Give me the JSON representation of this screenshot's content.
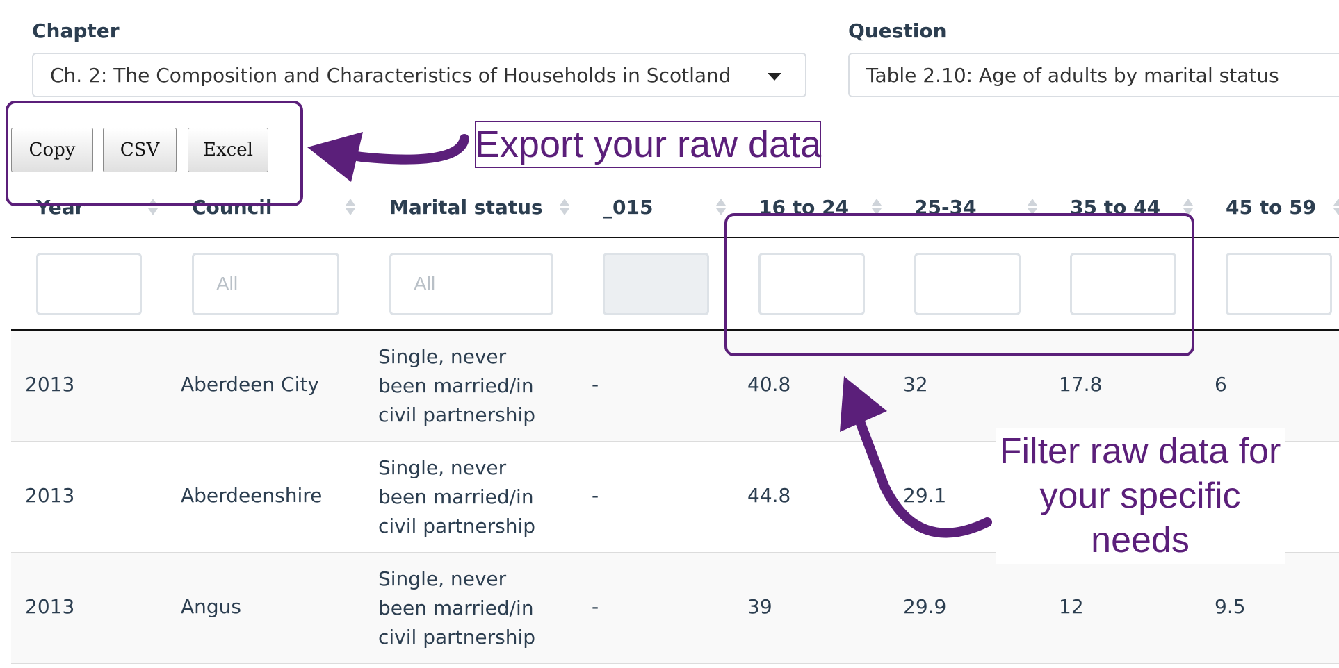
{
  "filters": {
    "chapter_label": "Chapter",
    "chapter_value": "Ch. 2: The Composition and Characteristics of Households in Scotland",
    "question_label": "Question",
    "question_value": "Table 2.10: Age of adults by marital status"
  },
  "export_buttons": {
    "copy": "Copy",
    "csv": "CSV",
    "excel": "Excel"
  },
  "table": {
    "columns": [
      "Year",
      "Council",
      "Marital status",
      "_015",
      "16 to 24",
      "25-34",
      "35 to 44",
      "45 to 59"
    ],
    "filter_placeholders": [
      "",
      "All",
      "All",
      "",
      "",
      "",
      "",
      ""
    ],
    "rows": [
      [
        "2013",
        "Aberdeen City",
        "Single, never been married/in civil partnership",
        "-",
        "40.8",
        "32",
        "17.8",
        "6"
      ],
      [
        "2013",
        "Aberdeenshire",
        "Single, never been married/in civil partnership",
        "-",
        "44.8",
        "29.1",
        "",
        ""
      ],
      [
        "2013",
        "Angus",
        "Single, never been married/in civil partnership",
        "-",
        "39",
        "29.9",
        "12",
        "9.5"
      ]
    ]
  },
  "annotations": {
    "export_text": "Export your raw data",
    "filter_text": "Filter raw data for your specific needs",
    "color": "#5b1f7a"
  }
}
